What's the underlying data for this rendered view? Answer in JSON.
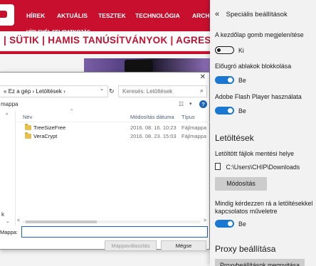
{
  "webpage": {
    "nav_items": [
      "HÍREK",
      "AKTUÁLIS",
      "TESZTEK",
      "TECHNOLÓGIA",
      "ARCH"
    ],
    "newsletter_tag": "HÍRLEVÉL FELIRATKOZÁS",
    "subnav_text": "| SÜTIK | HAMIS TANÚSÍTVÁNYOK | AGRESSZÍV",
    "brand_color": "#c8102e"
  },
  "dialog": {
    "close_glyph": "✕",
    "address": {
      "prefix": "«",
      "computer": "Ez a gép",
      "sep": "›",
      "folder": "Letöltések",
      "dropdown_glyph": "⌄",
      "refresh_glyph": "↻"
    },
    "search": {
      "placeholder": "Keresés: Letöltések",
      "icon": "search-icon"
    },
    "toolbar": {
      "mappa_label": "mappa",
      "view_glyph": "☷",
      "chevron_glyph": "▾",
      "help_glyph": "?"
    },
    "nav_pane": {
      "up_glyph": "^",
      "letter": "k"
    },
    "columns": {
      "name": "Név",
      "date": "Módosítás dátuma",
      "type": "Típus",
      "sort_glyph": "^"
    },
    "files": [
      {
        "name": "TreeSizeFree",
        "date": "2016. 08. 16. 10:23",
        "type": "Fájlmappa"
      },
      {
        "name": "VeraCrypt",
        "date": "2016. 08. 23. 15:03",
        "type": "Fájlmappa"
      }
    ],
    "hscroll": {
      "down_glyph": "⌄",
      "left_glyph": "<",
      "right_glyph": ">"
    },
    "folder_label": "Mappa:",
    "folder_value": "",
    "select_folder_label": "Mappaválasztás",
    "cancel_label": "Mégse"
  },
  "settings": {
    "back_glyph": "«",
    "title": "Speciális beállítások",
    "home_button_label": "A kezdőlap gomb megjelenítése",
    "home_button_state": "Ki",
    "popup_label": "Előugró ablakok blokkolása",
    "popup_state": "Be",
    "flash_label": "Adobe Flash Player használata",
    "flash_state": "Be",
    "downloads_heading": "Letöltések",
    "save_location_label": "Letöltött fájlok mentési helye",
    "download_path": "C:\\Users\\CHIP\\Downloads",
    "change_button_label": "Módosítás",
    "ask_label": "Mindig kérdezzen rá a letöltésekkel kapcsolatos műveletre",
    "ask_state": "Be",
    "proxy_heading": "Proxy beállítása",
    "proxy_button_label": "Proxybeállítások megnyitása",
    "accent_color": "#1a78d2"
  }
}
